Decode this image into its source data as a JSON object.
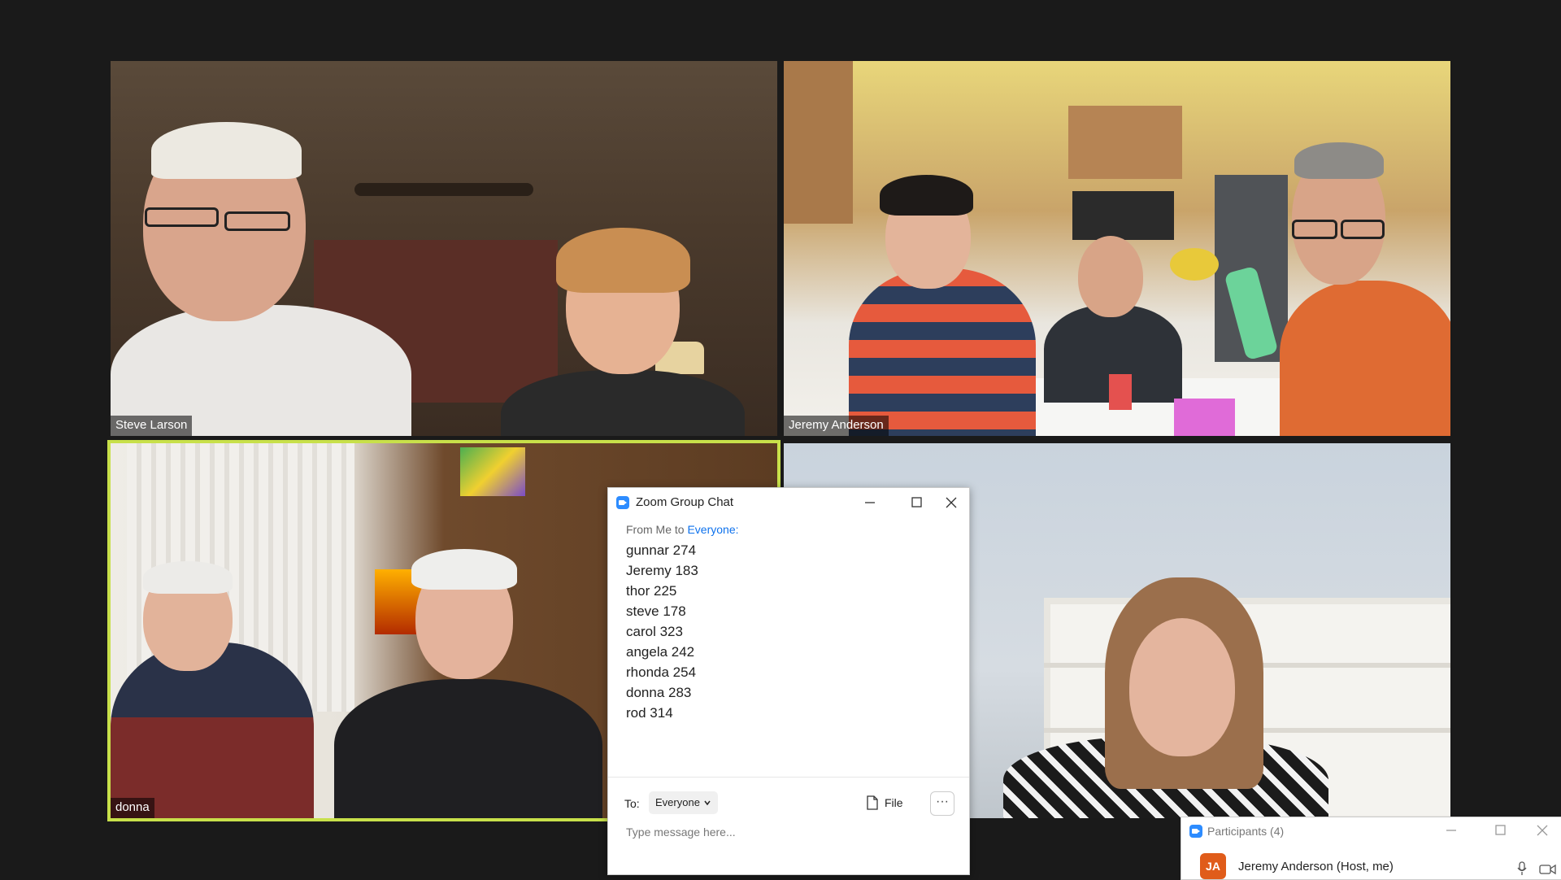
{
  "tiles": {
    "top_left_name": "Steve Larson",
    "top_right_name": "Jeremy Anderson",
    "bottom_left_name": "donna",
    "bottom_right_name": ""
  },
  "chat": {
    "title": "Zoom Group Chat",
    "from_prefix": "From Me to ",
    "recipient": "Everyone:",
    "messages": [
      "gunnar 274",
      "Jeremy 183",
      "thor 225",
      "steve 178",
      "carol 323",
      "angela 242",
      "rhonda 254",
      "donna 283",
      "rod 314"
    ],
    "to_label": "To:",
    "to_value": "Everyone",
    "file_label": "File",
    "more_label": "···",
    "input_placeholder": "Type message here..."
  },
  "participants": {
    "title": "Participants (4)",
    "first": {
      "initials": "JA",
      "name": "Jeremy Anderson (Host, me)"
    }
  },
  "colors": {
    "active_speaker_border": "#c8e04a",
    "zoom_blue": "#2d8cff",
    "link_blue": "#0e72ed",
    "avatar_orange": "#e05c1a"
  }
}
